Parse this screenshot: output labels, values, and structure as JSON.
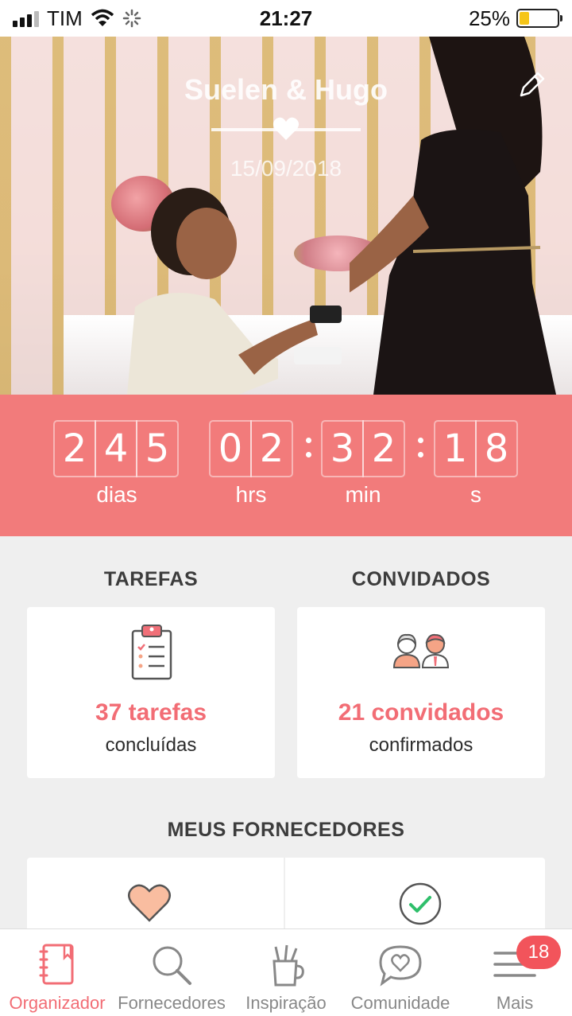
{
  "status_bar": {
    "carrier": "TIM",
    "time": "21:27",
    "battery": "25%",
    "battery_level": 0.25
  },
  "header": {
    "couple_names": "Suelen & Hugo",
    "wedding_date": "15/09/2018",
    "edit_icon": "pencil-icon",
    "divider_icon": "heart-icon"
  },
  "countdown": {
    "days": [
      "2",
      "4",
      "5"
    ],
    "hours": [
      "0",
      "2"
    ],
    "minutes": [
      "3",
      "2"
    ],
    "seconds": [
      "1",
      "8"
    ],
    "labels": {
      "days": "dias",
      "hours": "hrs",
      "minutes": "min",
      "seconds": "s"
    }
  },
  "tasks": {
    "title": "TAREFAS",
    "count_text": "37 tarefas",
    "sub_text": "concluídas",
    "icon": "clipboard-checklist-icon"
  },
  "guests": {
    "title": "CONVIDADOS",
    "count_text": "21 convidados",
    "sub_text": "confirmados",
    "icon": "couple-guests-icon"
  },
  "vendors": {
    "title": "MEUS FORNECEDORES",
    "cards": [
      {
        "icon": "heart-icon"
      },
      {
        "icon": "check-circle-icon"
      }
    ]
  },
  "tab_bar": {
    "items": [
      {
        "label": "Organizador",
        "icon": "notebook-icon",
        "active": true
      },
      {
        "label": "Fornecedores",
        "icon": "search-icon",
        "active": false
      },
      {
        "label": "Inspiração",
        "icon": "brush-cup-icon",
        "active": false
      },
      {
        "label": "Comunidade",
        "icon": "chat-heart-icon",
        "active": false
      },
      {
        "label": "Mais",
        "icon": "menu-icon",
        "active": false,
        "badge": "18"
      }
    ]
  },
  "colors": {
    "accent": "#f27b7b",
    "accent_text": "#f26d75",
    "badge": "#f2545b"
  }
}
